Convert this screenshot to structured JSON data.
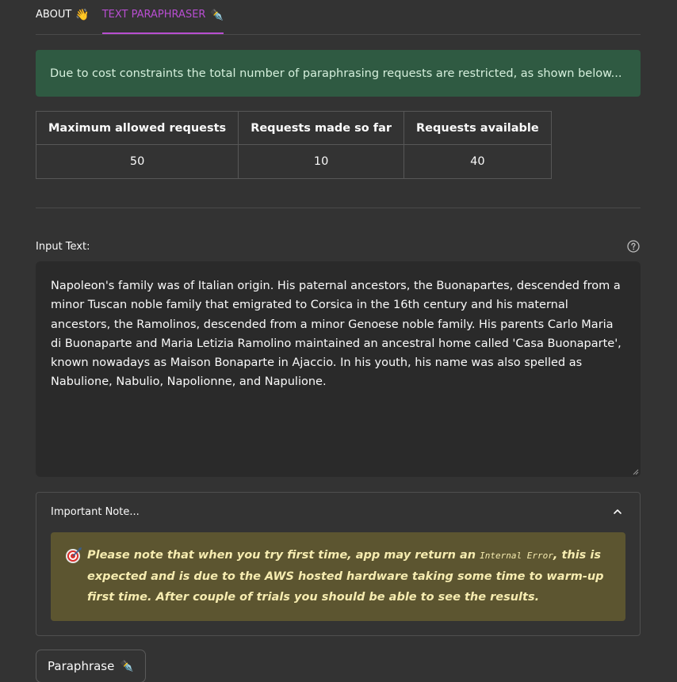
{
  "tabs": [
    {
      "label": "ABOUT",
      "emoji": "👋"
    },
    {
      "label": "TEXT PARAPHRASER",
      "emoji": "✒️"
    }
  ],
  "alert": {
    "text": "Due to cost constraints the total number of paraphrasing requests are restricted, as shown below..."
  },
  "table": {
    "headers": [
      "Maximum allowed requests",
      "Requests made so far",
      "Requests available"
    ],
    "row": [
      "50",
      "10",
      "40"
    ]
  },
  "input": {
    "label": "Input Text:",
    "value": "Napoleon's family was of Italian origin. His paternal ancestors, the Buonapartes, descended from a minor Tuscan noble family that emigrated to Corsica in the 16th century and his maternal ancestors, the Ramolinos, descended from a minor Genoese noble family. His parents Carlo Maria di Buonaparte and Maria Letizia Ramolino maintained an ancestral home called 'Casa Buonaparte', known nowadays as Maison Bonaparte in Ajaccio. In his youth, his name was also spelled as Nabulione, Nabulio, Napolionne, and Napulione."
  },
  "note": {
    "title": "Important Note...",
    "text_before": "Please note that when you try first time, app may return an ",
    "code": "Internal Error",
    "text_after": ", this is expected and is due to the AWS hosted hardware taking some time to warm-up first time. After couple of trials you should be able to see the results."
  },
  "button": {
    "label": "Paraphrase",
    "emoji": "✒️"
  },
  "colors": {
    "background": "#333333",
    "accent": "#b84ed1",
    "success_bg": "#2f5a42",
    "warning_bg": "#5c5530"
  },
  "icons": {
    "help": "question-circle-icon",
    "chevron": "chevron-up-icon",
    "target": "direct-hit-icon"
  }
}
